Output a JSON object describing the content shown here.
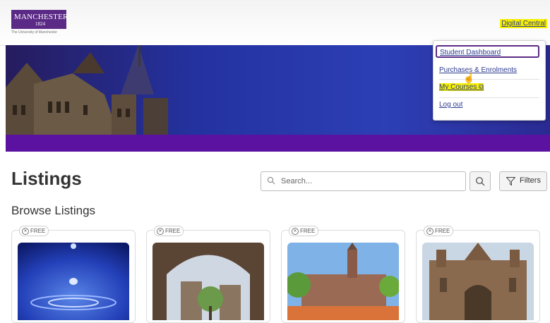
{
  "header": {
    "logo_text": "MANCHESTER",
    "logo_year": "1824",
    "logo_subtitle": "The University of Manchester",
    "account_link": "Digital Central"
  },
  "account_menu": {
    "items": [
      {
        "label": "Student Dashboard"
      },
      {
        "label": "Purchases & Enrolments"
      },
      {
        "label": "My Courses"
      },
      {
        "label": "Log out"
      }
    ]
  },
  "main": {
    "title": "Listings",
    "search_placeholder": "Search...",
    "filters_label": "Filters",
    "browse_heading": "Browse Listings"
  },
  "listings": [
    {
      "badge": "FREE",
      "image": "water-drop"
    },
    {
      "badge": "FREE",
      "image": "archway-building"
    },
    {
      "badge": "FREE",
      "image": "campus-tower"
    },
    {
      "badge": "FREE",
      "image": "gothic-building"
    }
  ],
  "colors": {
    "brand_purple": "#5b2a86",
    "hero_purple_band": "#5c12a0",
    "link_blue": "#2d3b8f",
    "highlight_yellow": "#f6f000"
  }
}
